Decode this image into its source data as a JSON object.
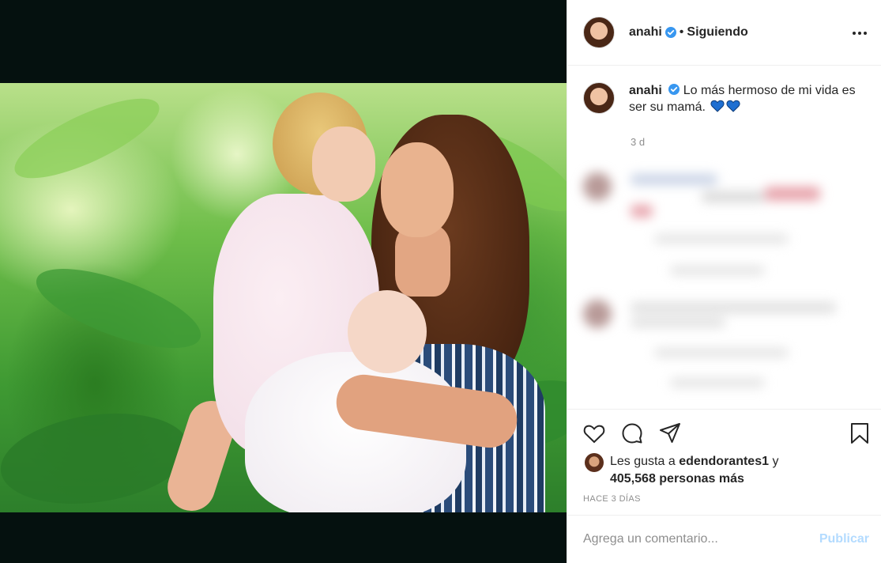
{
  "post": {
    "image_alt": "family photo in a tropical garden",
    "username": "anahi",
    "verified": true,
    "separator": "•",
    "follow_status": "Siguiendo",
    "caption": {
      "username": "anahi",
      "text": "Lo más hermoso de mi vida es ser su mamá.",
      "time": "3 d"
    },
    "likes": {
      "prefix": "Les gusta a",
      "liker": "edendorantes1",
      "conjunction": "y",
      "others": "405,568 personas más"
    },
    "timestamp_label": "HACE 3 DÍAS",
    "comment_box": {
      "placeholder": "Agrega un comentario...",
      "publish_label": "Publicar"
    }
  },
  "colors": {
    "verified": "#3897f0",
    "link_disabled": "#b3dbff",
    "heart": "#1f6fd1",
    "secondary_text": "#8e8e8e"
  },
  "icons": {
    "more": "more-icon",
    "like": "heart-icon",
    "comment": "comment-icon",
    "share": "share-icon",
    "save": "bookmark-icon"
  }
}
